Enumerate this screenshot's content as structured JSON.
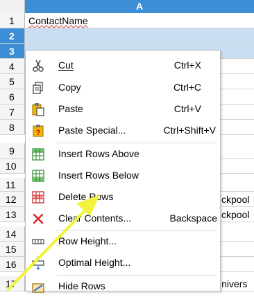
{
  "column_header": {
    "label": "A"
  },
  "rows": [
    {
      "num": "1",
      "value": "ContactName",
      "selected": false
    },
    {
      "num": "2",
      "value": "",
      "selected": true
    },
    {
      "num": "3",
      "value": "",
      "selected": true
    },
    {
      "num": "4",
      "value": "",
      "selected": false
    },
    {
      "num": "5",
      "value": "",
      "selected": false
    },
    {
      "num": "6",
      "value": "",
      "selected": false
    },
    {
      "num": "7",
      "value": "",
      "selected": false
    },
    {
      "num": "8",
      "value": "",
      "selected": false
    },
    {
      "num": "9",
      "value": "",
      "selected": false
    },
    {
      "num": "10",
      "value": "",
      "selected": false
    },
    {
      "num": "11",
      "value": "",
      "selected": false
    },
    {
      "num": "12",
      "value": "ckpool",
      "selected": false
    },
    {
      "num": "13",
      "value": "ckpool",
      "selected": false
    },
    {
      "num": "14",
      "value": "",
      "selected": false
    },
    {
      "num": "15",
      "value": "",
      "selected": false
    },
    {
      "num": "16",
      "value": "",
      "selected": false
    },
    {
      "num": "17",
      "value": "Univers",
      "selected": false
    }
  ],
  "context_menu": {
    "items": [
      {
        "label": "Cut",
        "shortcut": "Ctrl+X",
        "icon": "scissors-icon"
      },
      {
        "label": "Copy",
        "shortcut": "Ctrl+C",
        "icon": "copy-icon"
      },
      {
        "label": "Paste",
        "shortcut": "Ctrl+V",
        "icon": "paste-icon"
      },
      {
        "label": "Paste Special...",
        "shortcut": "Ctrl+Shift+V",
        "icon": "paste-special-icon"
      },
      {
        "label": "Insert Rows Above",
        "shortcut": "",
        "icon": "insert-rows-above-icon"
      },
      {
        "label": "Insert Rows Below",
        "shortcut": "",
        "icon": "insert-rows-below-icon"
      },
      {
        "label": "Delete Rows",
        "shortcut": "",
        "icon": "delete-rows-icon"
      },
      {
        "label": "Clear Contents...",
        "shortcut": "Backspace",
        "icon": "clear-contents-icon"
      },
      {
        "label": "Row Height...",
        "shortcut": "",
        "icon": "row-height-icon"
      },
      {
        "label": "Optimal Height...",
        "shortcut": "",
        "icon": "optimal-height-icon"
      },
      {
        "label": "Hide Rows",
        "shortcut": "",
        "icon": "hide-rows-icon"
      }
    ]
  },
  "colors": {
    "selection_header": "#3c8fd6",
    "selection_cell": "#c9def2",
    "annotation_arrow": "#f2f23a",
    "delete_icon_red": "#e02020"
  }
}
